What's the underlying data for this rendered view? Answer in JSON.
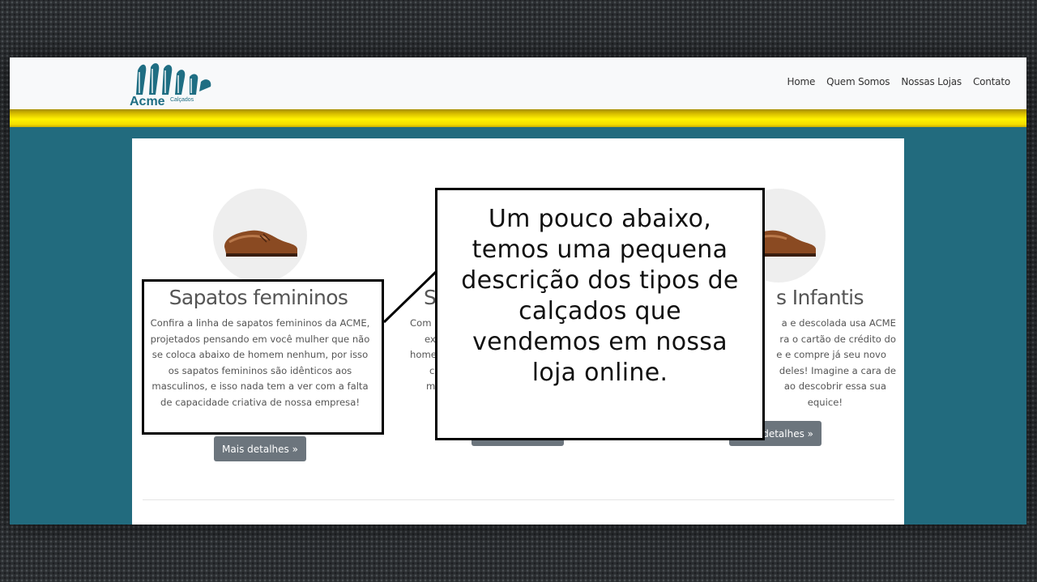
{
  "header": {
    "logo_main": "Acme",
    "logo_sub": "Calçados",
    "nav": [
      "Home",
      "Quem Somos",
      "Nossas Lojas",
      "Contato"
    ]
  },
  "colors": {
    "navbar": "#f8f9fa",
    "accent_yellow": "#fff200",
    "page_background": "#226b7e",
    "button": "#6c757d"
  },
  "features": [
    {
      "title": "Sapatos femininos",
      "description": "Confira a linha de sapatos femininos da ACME, projetados pensando em você mulher que não se coloca abaixo de homem nenhum, por isso os sapatos femininos são idênticos aos masculinos, e isso nada tem a ver com a falta de capacidade criativa de nossa empresa!",
      "button": "Mais detalhes »"
    },
    {
      "title": "S",
      "description_lines": [
        "Com",
        "ex",
        "home",
        "c",
        "m"
      ],
      "button": ""
    },
    {
      "title": "s Infantis",
      "description_lines": [
        "a e descolada usa ACME",
        "ra o cartão de crédito do",
        "e e compre já seu novo",
        "deles! Imagine a cara de",
        "ao descobrir essa sua",
        "equice!"
      ],
      "button": "detalhes »"
    }
  ],
  "callouts": {
    "main": "Um pouco abaixo, temos uma pequena descrição dos tipos de calçados que vendemos em nossa loja online."
  }
}
